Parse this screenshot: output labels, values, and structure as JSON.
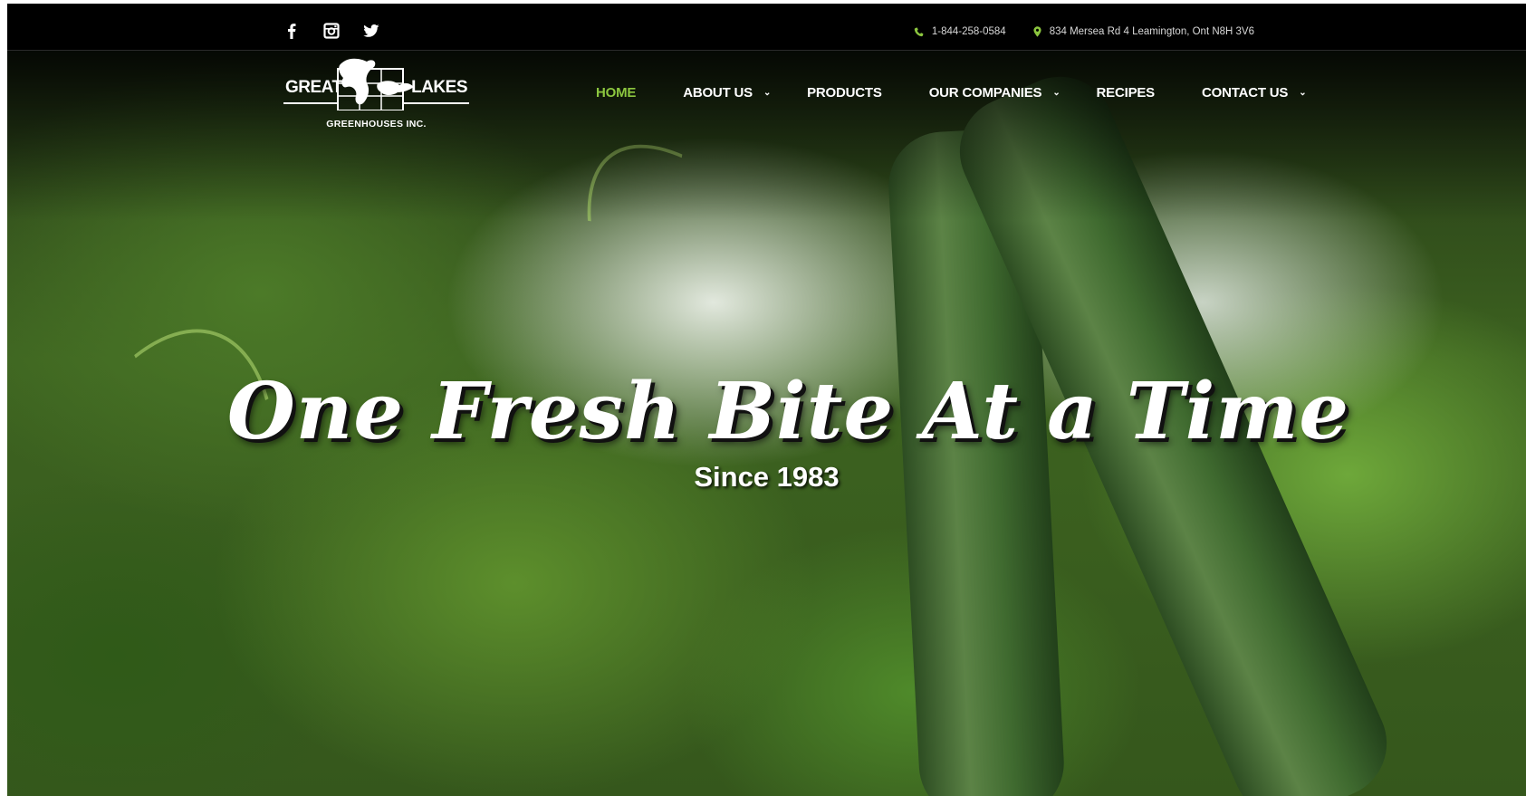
{
  "social": [
    {
      "icon": "facebook-icon"
    },
    {
      "icon": "instagram-icon"
    },
    {
      "icon": "twitter-icon"
    }
  ],
  "contact": {
    "phone": "1-844-258-0584",
    "address": "834 Mersea Rd 4 Leamington, Ont N8H 3V6",
    "icon_color": "#8cc63f"
  },
  "logo": {
    "left_word": "GREAT",
    "right_word": "LAKES",
    "subtitle": "GREENHOUSES INC."
  },
  "nav": {
    "active_color": "#8cc63f",
    "items": [
      {
        "label": "HOME",
        "dropdown": false,
        "active": true
      },
      {
        "label": "ABOUT US",
        "dropdown": true,
        "active": false
      },
      {
        "label": "PRODUCTS",
        "dropdown": false,
        "active": false
      },
      {
        "label": "OUR COMPANIES",
        "dropdown": true,
        "active": false
      },
      {
        "label": "RECIPES",
        "dropdown": false,
        "active": false
      },
      {
        "label": "CONTACT US",
        "dropdown": true,
        "active": false
      }
    ]
  },
  "hero": {
    "headline": "One Fresh Bite At a Time",
    "subheadline": "Since 1983"
  }
}
